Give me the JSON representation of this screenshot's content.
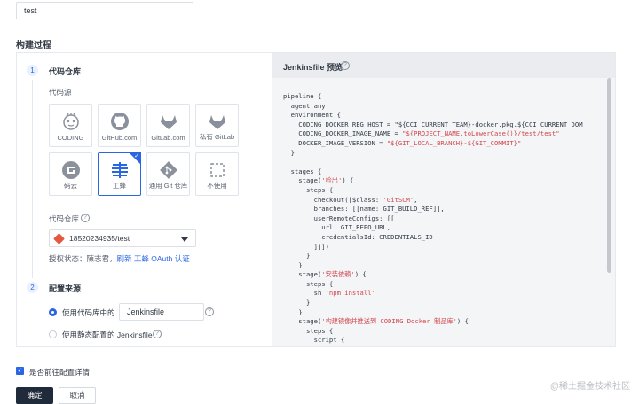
{
  "name_input": {
    "value": "test"
  },
  "section_title": "构建过程",
  "steps": {
    "step1": {
      "num": "1",
      "title": "代码仓库"
    },
    "step2": {
      "num": "2",
      "title": "配置来源"
    }
  },
  "source_label": "代码源",
  "sources": [
    {
      "label": "CODING",
      "icon": "coding-icon"
    },
    {
      "label": "GitHub.com",
      "icon": "github-icon"
    },
    {
      "label": "GitLab.com",
      "icon": "gitlab-icon"
    },
    {
      "label": "私有 GitLab",
      "icon": "gitlab-private-icon"
    },
    {
      "label": "码云",
      "icon": "gitee-icon"
    },
    {
      "label": "工蜂",
      "icon": "gongfeng-icon",
      "selected": true
    },
    {
      "label": "通用 Git 仓库",
      "icon": "git-icon"
    },
    {
      "label": "不使用",
      "icon": "none-icon"
    }
  ],
  "repo_label": "代码仓库",
  "repo_select": {
    "value": "18520234935/test"
  },
  "auth": {
    "prefix": "授权状态：",
    "user": "陳志君，",
    "link": "刷新 工蜂 OAuth 认证"
  },
  "config": {
    "option1_label": "使用代码库中的",
    "jenkinsfile_input": "Jenkinsfile",
    "option2_label": "使用静态配置的 Jenkinsfile"
  },
  "preview": {
    "title": "Jenkinsfile 预览",
    "code": [
      "pipeline {",
      "  agent any",
      "  environment {",
      "    CODING_DOCKER_REG_HOST = \"${CCI_CURRENT_TEAM}-docker.pkg.${CCI_CURRENT_DOM",
      "    CODING_DOCKER_IMAGE_NAME = \"${PROJECT_NAME.toLowerCase()}/test/test\"",
      "    DOCKER_IMAGE_VERSION = \"${GIT_LOCAL_BRANCH}-${GIT_COMMIT}\"",
      "  }",
      "",
      "  stages {",
      "    stage('检出') {",
      "      steps {",
      "        checkout([$class: 'GitSCM',",
      "        branches: [[name: GIT_BUILD_REF]],",
      "        userRemoteConfigs: [[",
      "          url: GIT_REPO_URL,",
      "          credentialsId: CREDENTIALS_ID",
      "        ]]])",
      "      }",
      "    }",
      "    stage('安装依赖') {",
      "      steps {",
      "        sh 'npm install'",
      "      }",
      "    }",
      "    stage('构建镜像并推送到 CODING Docker 制品库') {",
      "      steps {",
      "        script {"
    ]
  },
  "confirm_label": "是否前往配置详情",
  "buttons": {
    "ok": "确定",
    "cancel": "取消"
  },
  "watermark": "@稀土掘金技术社区",
  "colors": {
    "accent": "#2a66e3",
    "primary_button": "#1f2a3a"
  }
}
